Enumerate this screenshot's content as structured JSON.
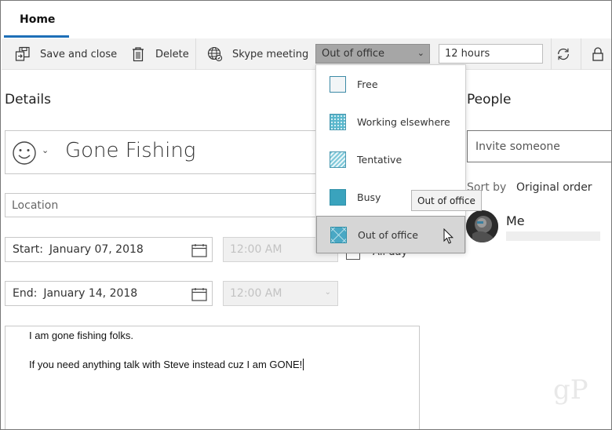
{
  "tabs": {
    "home": "Home"
  },
  "toolbar": {
    "save_close": "Save and close",
    "delete": "Delete",
    "skype": "Skype meeting",
    "status_value": "Out of office",
    "reminder_value": "12 hours"
  },
  "details": {
    "heading": "Details",
    "title": "Gone Fishing",
    "location_placeholder": "Location",
    "start_label": "Start:",
    "start_date": "January 07, 2018",
    "start_time": "12:00 AM",
    "end_label": "End:",
    "end_date": "January 14, 2018",
    "end_time": "12:00 AM",
    "allday": "All day",
    "notes_line1": "I am gone fishing folks.",
    "notes_line2": "If you need anything talk with Steve instead cuz I am GONE!"
  },
  "people": {
    "heading": "People",
    "invite_placeholder": "Invite someone",
    "sort_label": "Sort by",
    "sort_value": "Original order",
    "me": "Me"
  },
  "status_menu": {
    "items": [
      {
        "label": "Free",
        "color": "#f2f5f7"
      },
      {
        "label": "Working elsewhere",
        "color": "#59b7cc"
      },
      {
        "label": "Tentative",
        "color": "#7fc8d9"
      },
      {
        "label": "Busy",
        "color": "#3aa3bd"
      },
      {
        "label": "Out of office",
        "color": "#4aa8c4"
      }
    ],
    "selected_index": 4,
    "tooltip": "Out of office"
  },
  "watermark": "gP",
  "colors": {
    "accent": "#1e6fb7",
    "status_teal": "#4aa8c4"
  }
}
